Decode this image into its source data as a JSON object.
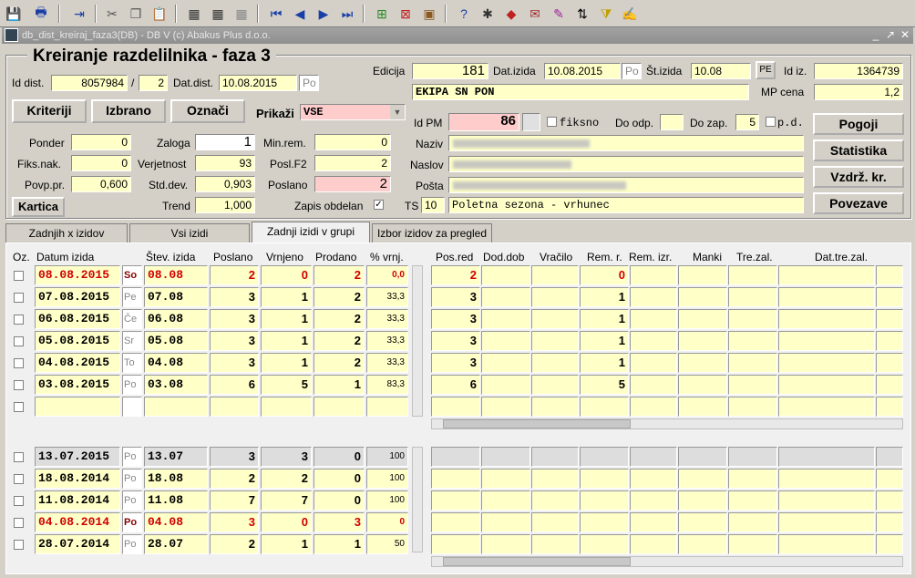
{
  "window": {
    "title": "db_dist_kreiraj_faza3(DB) - DB V (c) Abakus Plus d.o.o."
  },
  "heading": "Kreiranje razdelilnika - faza 3",
  "header": {
    "id_dist_label": "Id dist.",
    "id_dist": "8057984",
    "slash": "/",
    "id_dist2": "2",
    "dat_dist_label": "Dat.dist.",
    "dat_dist": "10.08.2015",
    "dat_dist_day": "Po",
    "edicija_label": "Edicija",
    "edicija": "181",
    "dat_izida_label": "Dat.izida",
    "dat_izida": "10.08.2015",
    "dat_izida_day": "Po",
    "st_izida_label": "Št.izida",
    "st_izida": "10.08",
    "pe_label": "PE",
    "id_iz_label": "Id iz.",
    "id_iz": "1364739",
    "edicija_name": "EKIPA SN PON",
    "mp_cena_label": "MP cena",
    "mp_cena": "1,2"
  },
  "buttons": {
    "kriteriji": "Kriteriji",
    "izbrano": "Izbrano",
    "oznaci": "Označi",
    "prikazi_label": "Prikaži",
    "prikazi_value": "VSE",
    "kartica": "Kartica",
    "pogoji": "Pogoji",
    "statistika": "Statistika",
    "vzdrz": "Vzdrž. kr.",
    "povezave": "Povezave"
  },
  "fields": {
    "ponder_label": "Ponder",
    "ponder": "0",
    "zaloga_label": "Zaloga",
    "zaloga": "1",
    "minrem_label": "Min.rem.",
    "minrem": "0",
    "fiksnak_label": "Fiks.nak.",
    "fiksnak": "0",
    "verjetnost_label": "Verjetnost",
    "verjetnost": "93",
    "poslf2_label": "Posl.F2",
    "poslf2": "2",
    "povppr_label": "Povp.pr.",
    "povppr": "0,600",
    "stddev_label": "Std.dev.",
    "stddev": "0,903",
    "poslano_label": "Poslano",
    "poslano": "2",
    "trend_label": "Trend",
    "trend": "1,000",
    "zapis_label": "Zapis obdelan",
    "idpm_label": "Id PM",
    "idpm": "86",
    "fiksno_label": "fiksno",
    "doodp_label": "Do odp.",
    "doodp": "",
    "dozap_label": "Do zap.",
    "dozap": "5",
    "pd_label": "p.d.",
    "naziv_label": "Naziv",
    "naslov_label": "Naslov",
    "posta_label": "Pošta",
    "ts_label": "TS",
    "ts": "10",
    "ts_value": "Poletna sezona - vrhunec"
  },
  "tabs": [
    "Zadnjih x izidov",
    "Vsi izidi",
    "Zadnji izidi v grupi",
    "Izbor izidov za pregled"
  ],
  "columns": [
    "Oz.",
    "Datum izida",
    "Štev. izida",
    "Poslano",
    "Vrnjeno",
    "Prodano",
    "% vrnj.",
    "Pos.red",
    "Dod.dob",
    "Vračilo",
    "Rem. r.",
    "Rem. izr.",
    "Manki",
    "Tre.zal.",
    "Dat.tre.zal."
  ],
  "rows_top": [
    {
      "date": "08.08.2015",
      "day": "So",
      "num": "08.08",
      "poslano": "2",
      "vrnjeno": "0",
      "prodano": "2",
      "pct": "0,0",
      "posred": "2",
      "rem": "0",
      "red": true
    },
    {
      "date": "07.08.2015",
      "day": "Pe",
      "num": "07.08",
      "poslano": "3",
      "vrnjeno": "1",
      "prodano": "2",
      "pct": "33,3",
      "posred": "3",
      "rem": "1",
      "red": false
    },
    {
      "date": "06.08.2015",
      "day": "Če",
      "num": "06.08",
      "poslano": "3",
      "vrnjeno": "1",
      "prodano": "2",
      "pct": "33,3",
      "posred": "3",
      "rem": "1",
      "red": false
    },
    {
      "date": "05.08.2015",
      "day": "Sr",
      "num": "05.08",
      "poslano": "3",
      "vrnjeno": "1",
      "prodano": "2",
      "pct": "33,3",
      "posred": "3",
      "rem": "1",
      "red": false
    },
    {
      "date": "04.08.2015",
      "day": "To",
      "num": "04.08",
      "poslano": "3",
      "vrnjeno": "1",
      "prodano": "2",
      "pct": "33,3",
      "posred": "3",
      "rem": "1",
      "red": false
    },
    {
      "date": "03.08.2015",
      "day": "Po",
      "num": "03.08",
      "poslano": "6",
      "vrnjeno": "5",
      "prodano": "1",
      "pct": "83,3",
      "posred": "6",
      "rem": "5",
      "red": false
    }
  ],
  "rows_bottom": [
    {
      "date": "13.07.2015",
      "day": "Po",
      "num": "13.07",
      "poslano": "3",
      "vrnjeno": "3",
      "prodano": "0",
      "pct": "100",
      "red": false
    },
    {
      "date": "18.08.2014",
      "day": "Po",
      "num": "18.08",
      "poslano": "2",
      "vrnjeno": "2",
      "prodano": "0",
      "pct": "100",
      "red": false
    },
    {
      "date": "11.08.2014",
      "day": "Po",
      "num": "11.08",
      "poslano": "7",
      "vrnjeno": "7",
      "prodano": "0",
      "pct": "100",
      "red": false
    },
    {
      "date": "04.08.2014",
      "day": "Po",
      "num": "04.08",
      "poslano": "3",
      "vrnjeno": "0",
      "prodano": "3",
      "pct": "0",
      "red": true
    },
    {
      "date": "28.07.2014",
      "day": "Po",
      "num": "28.07",
      "poslano": "2",
      "vrnjeno": "1",
      "prodano": "1",
      "pct": "50",
      "red": false
    }
  ]
}
